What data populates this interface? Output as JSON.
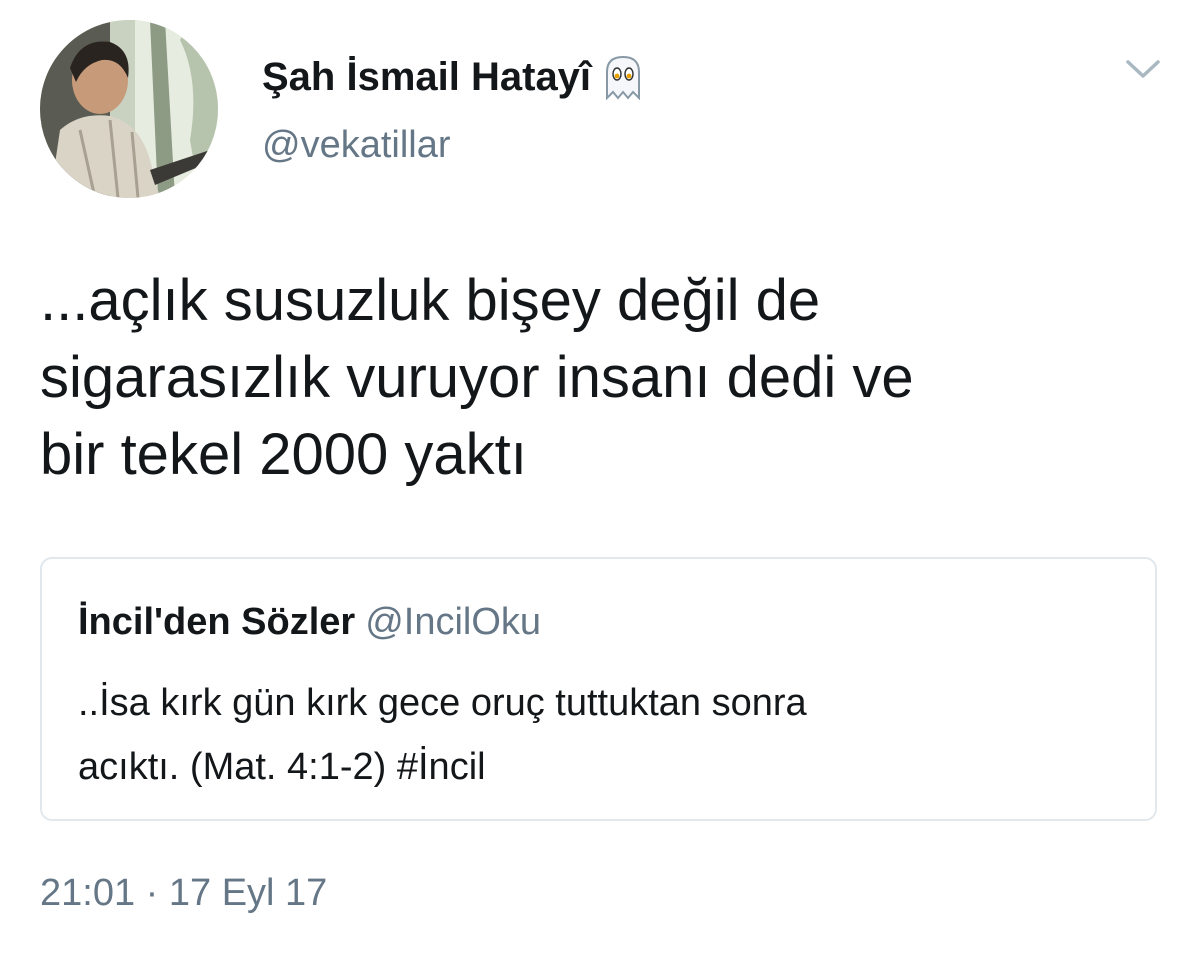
{
  "author": {
    "display_name": "Şah İsmail Hatayî",
    "handle": "@vekatillar",
    "name_emoji": "ghost-icon"
  },
  "tweet": {
    "text_lines": [
      "...açlık susuzluk bişey değil de",
      "sigarasızlık vuruyor insanı dedi ve",
      "bir tekel 2000 yaktı"
    ],
    "timestamp": "21:01 · 17 Eyl 17"
  },
  "quoted_tweet": {
    "display_name": "İncil'den Sözler",
    "handle": "@IncilOku",
    "text_lines": [
      "..İsa kırk gün kırk gece oruç tuttuktan sonra",
      "acıktı. (Mat. 4:1-2) #İncil"
    ]
  },
  "icons": {
    "menu": "chevron-down-icon",
    "avatar": "avatar"
  },
  "colors": {
    "text_primary": "#14171a",
    "text_secondary": "#657786",
    "border": "#e1e8ed"
  }
}
